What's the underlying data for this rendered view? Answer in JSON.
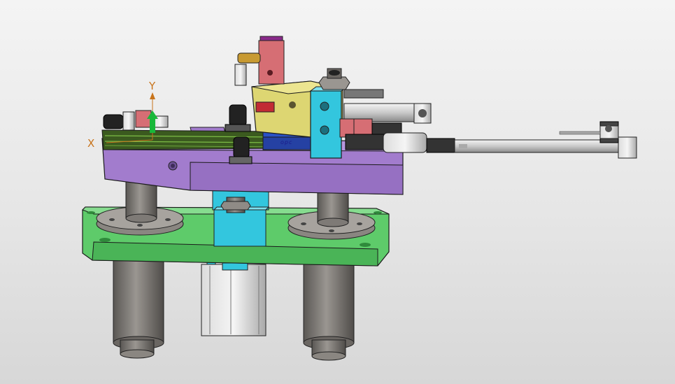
{
  "viewport": {
    "triad": {
      "x_label": "X",
      "y_label": "Y"
    },
    "part_marking": "opc",
    "colors": {
      "background_top": "#f4f4f4",
      "background_bottom": "#d7d7d7",
      "base_plate": "#5ecb6a",
      "top_plate": "#a27ccd",
      "steel": "#7d7975",
      "cyan_block": "#33c6de",
      "yellow_block": "#ddd672",
      "red_block": "#d66e74",
      "blue_block": "#2b52c6",
      "axis_label": "#c8741c",
      "triad_y_arrow": "#19b83a"
    }
  }
}
